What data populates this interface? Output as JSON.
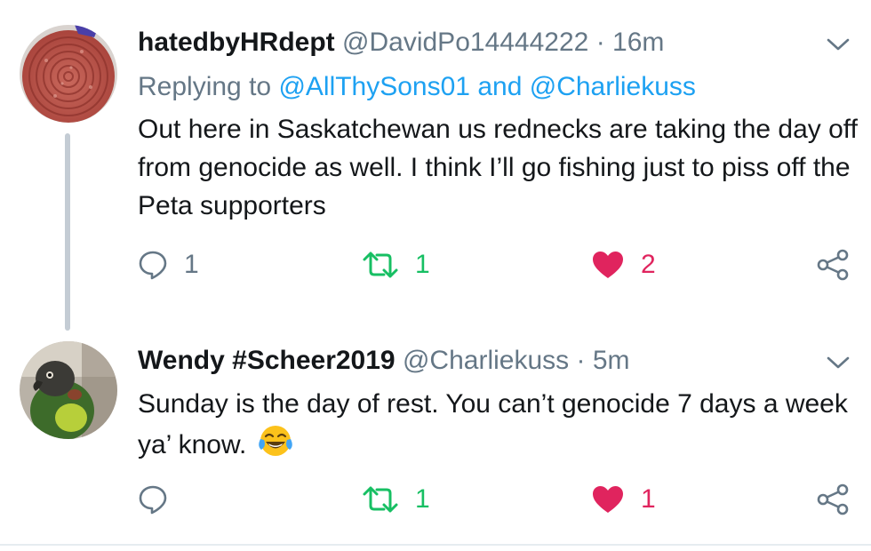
{
  "tweets": [
    {
      "author_name": "hatedbyHRdept",
      "author_handle": "@DavidPo14444222",
      "separator": "·",
      "time": "16m",
      "reply_prefix": "Replying to",
      "reply_mention_1": "@AllThySons01",
      "reply_and": "and",
      "reply_mention_2": "@Charliekuss",
      "text": "Out here in Saskatchewan us rednecks are taking the day off from genocide as well. I think I’ll go fishing just to piss off the Peta supporters",
      "reply_count": "1",
      "retweet_count": "1",
      "like_count": "2",
      "liked": true
    },
    {
      "author_name": "Wendy #Scheer2019",
      "author_handle": "@Charliekuss",
      "separator": "·",
      "time": "5m",
      "text": "Sunday is the day of rest. You can’t genocide 7 days a week ya’ know.",
      "emoji": "face-with-tears-of-joy",
      "reply_count": "",
      "retweet_count": "1",
      "like_count": "1",
      "liked": true
    }
  ],
  "colors": {
    "text": "#14171a",
    "muted": "#657786",
    "link": "#1da1f2",
    "retweet": "#17bf63",
    "like": "#e0245e",
    "thread_line": "#c4ccd4"
  }
}
